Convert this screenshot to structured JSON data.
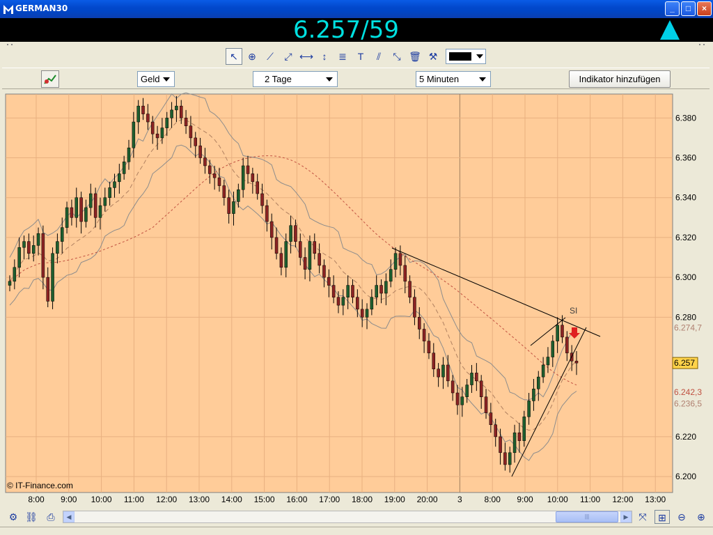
{
  "window": {
    "title": "GERMAN30",
    "min": "_",
    "max": "□",
    "close": "×"
  },
  "quote": {
    "price": "6.257/59",
    "direction_icon": "up-arrow-icon",
    "color": "#00e0e0"
  },
  "drawing_tools": [
    {
      "name": "pointer-tool",
      "glyph": "↖"
    },
    {
      "name": "zoom-tool",
      "glyph": "⊕"
    },
    {
      "name": "line-tool",
      "glyph": "⟋"
    },
    {
      "name": "ray-tool",
      "glyph": "⤢"
    },
    {
      "name": "horizontal-line-tool",
      "glyph": "⟷"
    },
    {
      "name": "vertical-line-tool",
      "glyph": "↕"
    },
    {
      "name": "fibonacci-tool",
      "glyph": "≣"
    },
    {
      "name": "text-tool",
      "glyph": "T"
    },
    {
      "name": "parallel-channel-tool",
      "glyph": "⫽"
    },
    {
      "name": "regression-tool",
      "glyph": "⤡"
    },
    {
      "name": "delete-tool",
      "glyph": "🗑"
    },
    {
      "name": "settings-tool",
      "glyph": "⚒"
    }
  ],
  "options": {
    "price_type": "Geld",
    "range": "2 Tage",
    "interval": "5 Minuten",
    "add_indicator": "Indikator hinzufügen"
  },
  "chart_data": {
    "type": "candlestick",
    "instrument": "GERMAN30",
    "copyright": "© IT-Finance.com",
    "x_ticks": [
      "8:00",
      "9:00",
      "10:00",
      "11:00",
      "12:00",
      "13:00",
      "14:00",
      "15:00",
      "16:00",
      "17:00",
      "18:00",
      "19:00",
      "20:00",
      "3",
      "8:00",
      "9:00",
      "10:00",
      "11:00",
      "12:00",
      "13:00"
    ],
    "y_ticks": [
      "6.380",
      "6.360",
      "6.340",
      "6.320",
      "6.300",
      "6.280",
      "6.220",
      "6.200"
    ],
    "ylim": [
      6.192,
      6.392
    ],
    "price_labels": [
      {
        "text": "6.274,7",
        "value": 6.2747,
        "style": "band"
      },
      {
        "text": "6.257",
        "value": 6.257,
        "style": "current"
      },
      {
        "text": "6.242,3",
        "value": 6.2423,
        "style": "ma"
      },
      {
        "text": "6.236,5",
        "value": 6.2365,
        "style": "band"
      }
    ],
    "annotation": "SI",
    "closes": [
      6.298,
      6.305,
      6.315,
      6.318,
      6.312,
      6.316,
      6.322,
      6.3,
      6.288,
      6.312,
      6.318,
      6.325,
      6.335,
      6.33,
      6.34,
      6.328,
      6.335,
      6.342,
      6.33,
      6.336,
      6.34,
      6.345,
      6.348,
      6.352,
      6.358,
      6.365,
      6.378,
      6.386,
      6.382,
      6.378,
      6.372,
      6.37,
      6.375,
      6.38,
      6.384,
      6.386,
      6.38,
      6.376,
      6.37,
      6.366,
      6.36,
      6.356,
      6.352,
      6.35,
      6.346,
      6.34,
      6.332,
      6.338,
      6.344,
      6.356,
      6.352,
      6.348,
      6.342,
      6.336,
      6.328,
      6.32,
      6.312,
      6.305,
      6.318,
      6.326,
      6.318,
      6.31,
      6.304,
      6.318,
      6.312,
      6.306,
      6.3,
      6.296,
      6.29,
      6.286,
      6.29,
      6.296,
      6.29,
      6.284,
      6.28,
      6.284,
      6.29,
      6.296,
      6.292,
      6.298,
      6.304,
      6.312,
      6.306,
      6.298,
      6.29,
      6.28,
      6.274,
      6.268,
      6.262,
      6.254,
      6.25,
      6.256,
      6.248,
      6.242,
      6.236,
      6.24,
      6.246,
      6.252,
      6.248,
      6.24,
      6.232,
      6.226,
      6.22,
      6.212,
      6.206,
      6.212,
      6.222,
      6.218,
      6.23,
      6.238,
      6.244,
      6.25,
      6.256,
      6.26,
      6.268,
      6.276,
      6.27,
      6.262,
      6.258,
      6.257
    ]
  }
}
